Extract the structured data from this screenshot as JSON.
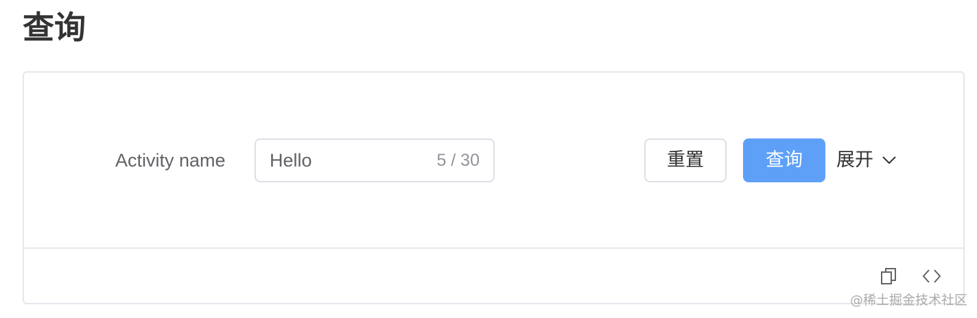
{
  "page": {
    "title": "查询"
  },
  "form": {
    "field_label": "Activity name",
    "input_value": "Hello",
    "char_count": "5 / 30",
    "reset_label": "重置",
    "query_label": "查询",
    "expand_label": "展开"
  },
  "icons": {
    "expand": "chevron-down-icon",
    "copy": "copy-icon",
    "code": "code-icon"
  },
  "watermark": "@稀土掘金技术社区",
  "colors": {
    "primary": "#5ea0f7",
    "border": "#dcdfe6",
    "label": "#606266"
  }
}
